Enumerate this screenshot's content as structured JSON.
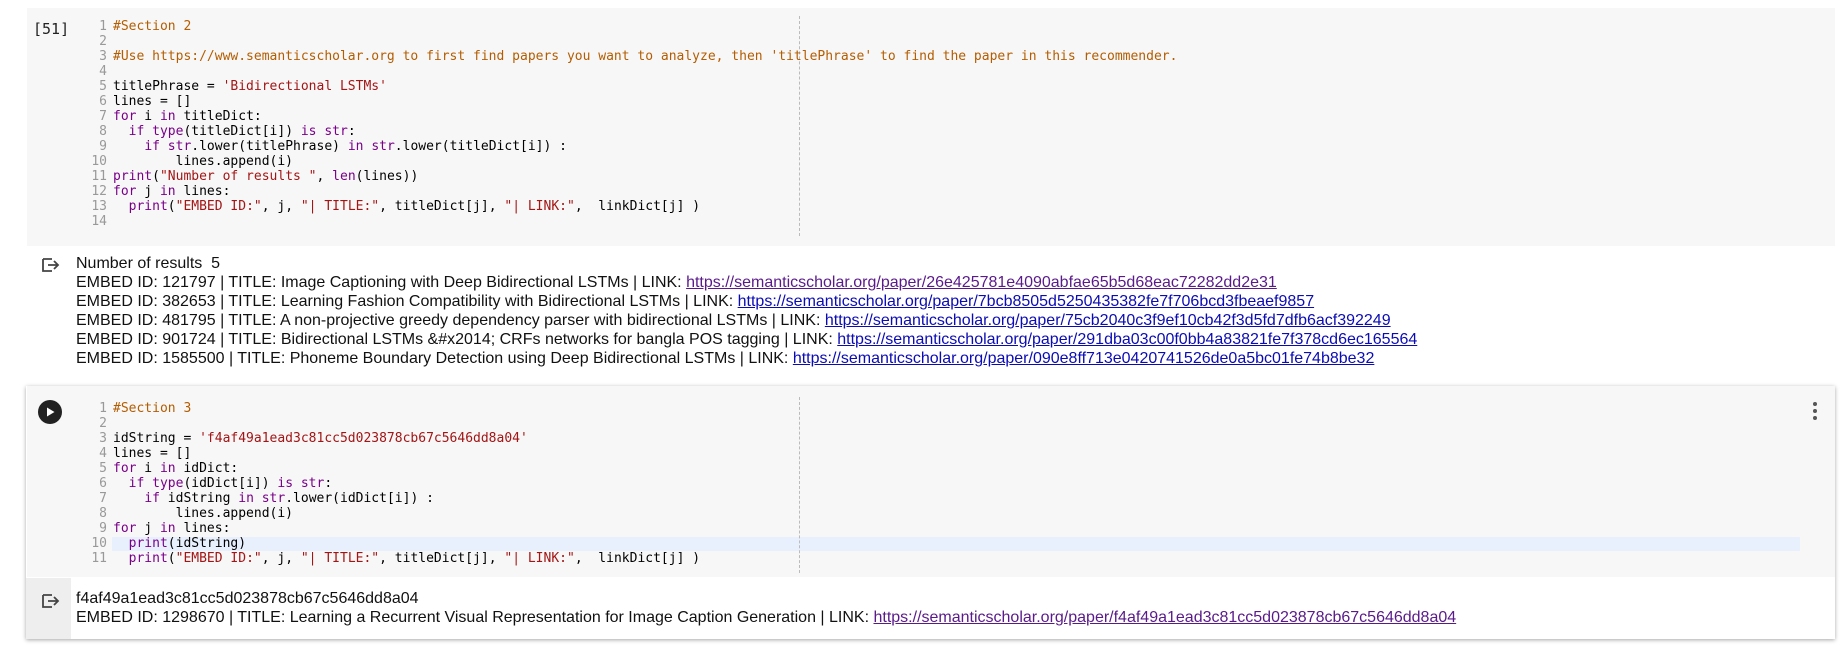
{
  "cell1": {
    "execution_count": "[51]",
    "lines": [
      {
        "n": "1",
        "parts": [
          {
            "t": "#Section 2",
            "c": "com"
          }
        ]
      },
      {
        "n": "2",
        "parts": []
      },
      {
        "n": "3",
        "parts": [
          {
            "t": "#Use https://www.semanticscholar.org to first find papers you want to analyze, then 'titlePhrase' to find the paper in this recommender.",
            "c": "com"
          }
        ]
      },
      {
        "n": "4",
        "parts": []
      },
      {
        "n": "5",
        "parts": [
          {
            "t": "titlePhrase = ",
            "c": ""
          },
          {
            "t": "'Bidirectional LSTMs'",
            "c": "str"
          }
        ]
      },
      {
        "n": "6",
        "parts": [
          {
            "t": "lines = []",
            "c": ""
          }
        ]
      },
      {
        "n": "7",
        "parts": [
          {
            "t": "for",
            "c": "kw"
          },
          {
            "t": " i ",
            "c": ""
          },
          {
            "t": "in",
            "c": "kw"
          },
          {
            "t": " titleDict:",
            "c": ""
          }
        ]
      },
      {
        "n": "8",
        "parts": [
          {
            "t": "  ",
            "c": ""
          },
          {
            "t": "if",
            "c": "kw"
          },
          {
            "t": " ",
            "c": ""
          },
          {
            "t": "type",
            "c": "bi"
          },
          {
            "t": "(titleDict[i]) ",
            "c": ""
          },
          {
            "t": "is",
            "c": "kw"
          },
          {
            "t": " ",
            "c": ""
          },
          {
            "t": "str",
            "c": "bi"
          },
          {
            "t": ":",
            "c": ""
          }
        ]
      },
      {
        "n": "9",
        "parts": [
          {
            "t": "    ",
            "c": ""
          },
          {
            "t": "if",
            "c": "kw"
          },
          {
            "t": " ",
            "c": ""
          },
          {
            "t": "str",
            "c": "bi"
          },
          {
            "t": ".lower(titlePhrase) ",
            "c": ""
          },
          {
            "t": "in",
            "c": "kw"
          },
          {
            "t": " ",
            "c": ""
          },
          {
            "t": "str",
            "c": "bi"
          },
          {
            "t": ".lower(titleDict[i]) :",
            "c": ""
          }
        ]
      },
      {
        "n": "10",
        "parts": [
          {
            "t": "        lines.append(i)",
            "c": ""
          }
        ]
      },
      {
        "n": "11",
        "parts": [
          {
            "t": "print",
            "c": "bi"
          },
          {
            "t": "(",
            "c": ""
          },
          {
            "t": "\"Number of results \"",
            "c": "str"
          },
          {
            "t": ", ",
            "c": ""
          },
          {
            "t": "len",
            "c": "bi"
          },
          {
            "t": "(lines))",
            "c": ""
          }
        ]
      },
      {
        "n": "12",
        "parts": [
          {
            "t": "for",
            "c": "kw"
          },
          {
            "t": " j ",
            "c": ""
          },
          {
            "t": "in",
            "c": "kw"
          },
          {
            "t": " lines:",
            "c": ""
          }
        ]
      },
      {
        "n": "13",
        "parts": [
          {
            "t": "  ",
            "c": ""
          },
          {
            "t": "print",
            "c": "bi"
          },
          {
            "t": "(",
            "c": ""
          },
          {
            "t": "\"EMBED ID:\"",
            "c": "str"
          },
          {
            "t": ", j, ",
            "c": ""
          },
          {
            "t": "\"| TITLE:\"",
            "c": "str"
          },
          {
            "t": ", titleDict[j], ",
            "c": ""
          },
          {
            "t": "\"| LINK:\"",
            "c": "str"
          },
          {
            "t": ",  linkDict[j] )",
            "c": ""
          }
        ]
      },
      {
        "n": "14",
        "parts": []
      }
    ],
    "output": [
      {
        "text": "Number of results  5",
        "link": ""
      },
      {
        "text": "EMBED ID: 121797 | TITLE: Image Captioning with Deep Bidirectional LSTMs | LINK: ",
        "link": "https://semanticscholar.org/paper/26e425781e4090abfae65b5d68eac72282dd2e31",
        "visited": true
      },
      {
        "text": "EMBED ID: 382653 | TITLE: Learning Fashion Compatibility with Bidirectional LSTMs | LINK: ",
        "link": "https://semanticscholar.org/paper/7bcb8505d5250435382fe7f706bcd3fbeaef9857",
        "visited": false
      },
      {
        "text": "EMBED ID: 481795 | TITLE: A non-projective greedy dependency parser with bidirectional LSTMs | LINK: ",
        "link": "https://semanticscholar.org/paper/75cb2040c3f9ef10cb42f3d5fd7dfb6acf392249",
        "visited": false
      },
      {
        "text": "EMBED ID: 901724 | TITLE: Bidirectional LSTMs &#x2014; CRFs networks for bangla POS tagging | LINK: ",
        "link": "https://semanticscholar.org/paper/291dba03c00f0bb4a83821fe7f378cd6ec165564",
        "visited": false
      },
      {
        "text": "EMBED ID: 1585500 | TITLE: Phoneme Boundary Detection using Deep Bidirectional LSTMs | LINK: ",
        "link": "https://semanticscholar.org/paper/090e8ff713e0420741526de0a5bc01fe74b8be32",
        "visited": false
      }
    ]
  },
  "cell2": {
    "lines": [
      {
        "n": "1",
        "parts": [
          {
            "t": "#Section 3",
            "c": "com"
          }
        ]
      },
      {
        "n": "2",
        "parts": []
      },
      {
        "n": "3",
        "parts": [
          {
            "t": "idString = ",
            "c": ""
          },
          {
            "t": "'f4af49a1ead3c81cc5d023878cb67c5646dd8a04'",
            "c": "str"
          }
        ]
      },
      {
        "n": "4",
        "parts": [
          {
            "t": "lines = []",
            "c": ""
          }
        ]
      },
      {
        "n": "5",
        "parts": [
          {
            "t": "for",
            "c": "kw"
          },
          {
            "t": " i ",
            "c": ""
          },
          {
            "t": "in",
            "c": "kw"
          },
          {
            "t": " idDict:",
            "c": ""
          }
        ]
      },
      {
        "n": "6",
        "parts": [
          {
            "t": "  ",
            "c": ""
          },
          {
            "t": "if",
            "c": "kw"
          },
          {
            "t": " ",
            "c": ""
          },
          {
            "t": "type",
            "c": "bi"
          },
          {
            "t": "(idDict[i]) ",
            "c": ""
          },
          {
            "t": "is",
            "c": "kw"
          },
          {
            "t": " ",
            "c": ""
          },
          {
            "t": "str",
            "c": "bi"
          },
          {
            "t": ":",
            "c": ""
          }
        ]
      },
      {
        "n": "7",
        "parts": [
          {
            "t": "    ",
            "c": ""
          },
          {
            "t": "if",
            "c": "kw"
          },
          {
            "t": " idString ",
            "c": ""
          },
          {
            "t": "in",
            "c": "kw"
          },
          {
            "t": " ",
            "c": ""
          },
          {
            "t": "str",
            "c": "bi"
          },
          {
            "t": ".lower(idDict[i]) :",
            "c": ""
          }
        ]
      },
      {
        "n": "8",
        "parts": [
          {
            "t": "        lines.append(i)",
            "c": ""
          }
        ]
      },
      {
        "n": "9",
        "parts": [
          {
            "t": "for",
            "c": "kw"
          },
          {
            "t": " j ",
            "c": ""
          },
          {
            "t": "in",
            "c": "kw"
          },
          {
            "t": " lines:",
            "c": ""
          }
        ]
      },
      {
        "n": "10",
        "parts": [
          {
            "t": "  ",
            "c": ""
          },
          {
            "t": "print",
            "c": "bi"
          },
          {
            "t": "(idString)",
            "c": ""
          }
        ]
      },
      {
        "n": "11",
        "parts": [
          {
            "t": "  ",
            "c": ""
          },
          {
            "t": "print",
            "c": "bi"
          },
          {
            "t": "(",
            "c": ""
          },
          {
            "t": "\"EMBED ID:\"",
            "c": "str"
          },
          {
            "t": ", j, ",
            "c": ""
          },
          {
            "t": "\"| TITLE:\"",
            "c": "str"
          },
          {
            "t": ", titleDict[j], ",
            "c": ""
          },
          {
            "t": "\"| LINK:\"",
            "c": "str"
          },
          {
            "t": ",  linkDict[j] )",
            "c": ""
          }
        ]
      }
    ],
    "output": [
      {
        "text": "f4af49a1ead3c81cc5d023878cb67c5646dd8a04",
        "link": ""
      },
      {
        "text": "EMBED ID: 1298670 | TITLE: Learning a Recurrent Visual Representation for Image Caption Generation | LINK: ",
        "link": "https://semanticscholar.org/paper/f4af49a1ead3c81cc5d023878cb67c5646dd8a04",
        "visited": true
      }
    ]
  },
  "icons": {
    "run": "play-icon",
    "more": "more-vert-icon",
    "output": "output-arrow-icon"
  },
  "colors": {
    "comment": "#b45d00",
    "string": "#a31515",
    "keyword": "#7a008a",
    "link": "#0b0bb5",
    "visited_link": "#5a1a8a"
  }
}
